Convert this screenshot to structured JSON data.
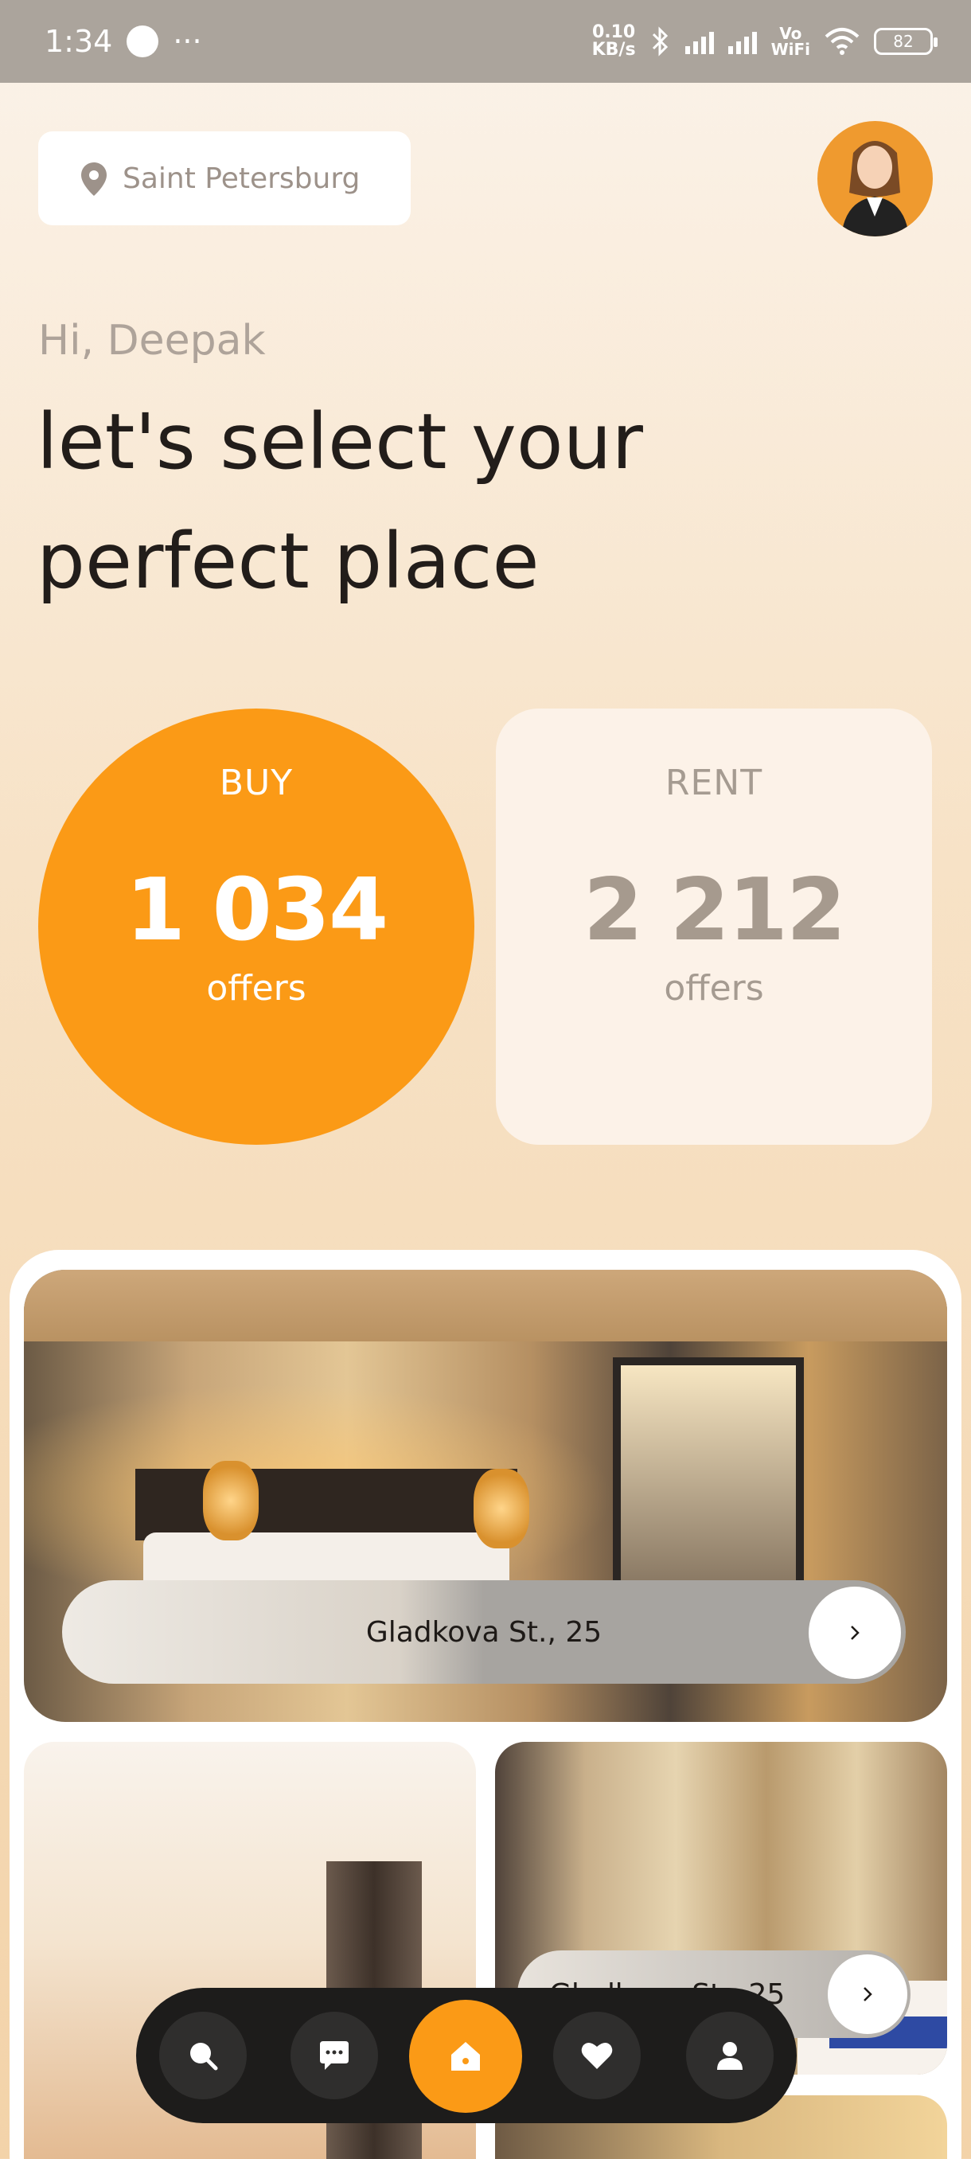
{
  "status_bar": {
    "time": "1:34",
    "more": "···",
    "net_speed_value": "0.10",
    "net_speed_unit": "KB/s",
    "vo_label": "Vo",
    "wifi_label": "WiFi",
    "battery": "82"
  },
  "location": {
    "city": "Saint Petersburg"
  },
  "greeting": "Hi, Deepak",
  "headline": "let's select your perfect place",
  "buy": {
    "label": "BUY",
    "count": "1 034",
    "unit": "offers"
  },
  "rent": {
    "label": "RENT",
    "count": "2 212",
    "unit": "offers"
  },
  "listings": [
    {
      "address": "Gladkova St., 25"
    },
    {
      "address": "Gladkova St., 25"
    }
  ],
  "nav": {
    "items": [
      "search",
      "chat",
      "home",
      "favorites",
      "profile"
    ],
    "active": "home"
  },
  "colors": {
    "accent": "#fb9a16",
    "nav_bg": "#1d1c1b",
    "rent_card_bg": "#fcf2e8"
  }
}
